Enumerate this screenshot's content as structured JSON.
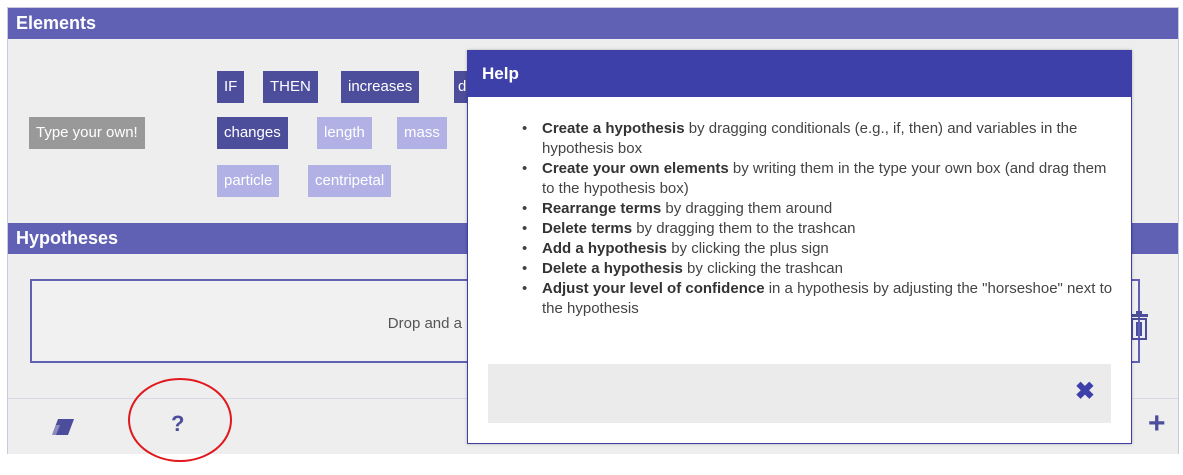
{
  "sections": {
    "elements_title": "Elements",
    "hypotheses_title": "Hypotheses"
  },
  "elements": {
    "type_own_label": "Type your own!",
    "chips": [
      {
        "label": "IF",
        "style": "dark"
      },
      {
        "label": "THEN",
        "style": "dark"
      },
      {
        "label": "increases",
        "style": "dark"
      },
      {
        "label": "d",
        "style": "dark"
      },
      {
        "label": "changes",
        "style": "dark"
      },
      {
        "label": "length",
        "style": "light"
      },
      {
        "label": "mass",
        "style": "light"
      },
      {
        "label": "particle",
        "style": "light"
      },
      {
        "label": "centripetal",
        "style": "light"
      }
    ]
  },
  "hypotheses": {
    "drop_text": "Drop and a"
  },
  "bottom_bar": {
    "eraser_icon": "eraser-icon",
    "help_icon_glyph": "?",
    "add_icon_glyph": "+",
    "trash_icon": "trashcan-icon"
  },
  "help_dialog": {
    "title": "Help",
    "items": [
      {
        "bold": "Create a hypothesis",
        "rest": " by dragging conditionals (e.g., if, then) and variables in the hypothesis box"
      },
      {
        "bold": "Create your own elements",
        "rest": " by writing them in the type your own box (and drag them to the hypothesis box)"
      },
      {
        "bold": "Rearrange terms",
        "rest": " by dragging them around"
      },
      {
        "bold": "Delete terms",
        "rest": " by dragging them to the trashcan"
      },
      {
        "bold": "Add a hypothesis",
        "rest": " by clicking the plus sign"
      },
      {
        "bold": "Delete a hypothesis",
        "rest": " by clicking the trashcan"
      },
      {
        "bold": "Adjust your level of confidence",
        "rest": " in a hypothesis by adjusting the \"horseshoe\" next to the hypothesis"
      }
    ],
    "close_glyph": "✖"
  },
  "colors": {
    "accent": "#6061b5",
    "chip_dark": "#4c4d9b",
    "chip_light": "#b1b1e6",
    "help_header": "#3e40a9",
    "annotation_circle": "#e0191e"
  }
}
